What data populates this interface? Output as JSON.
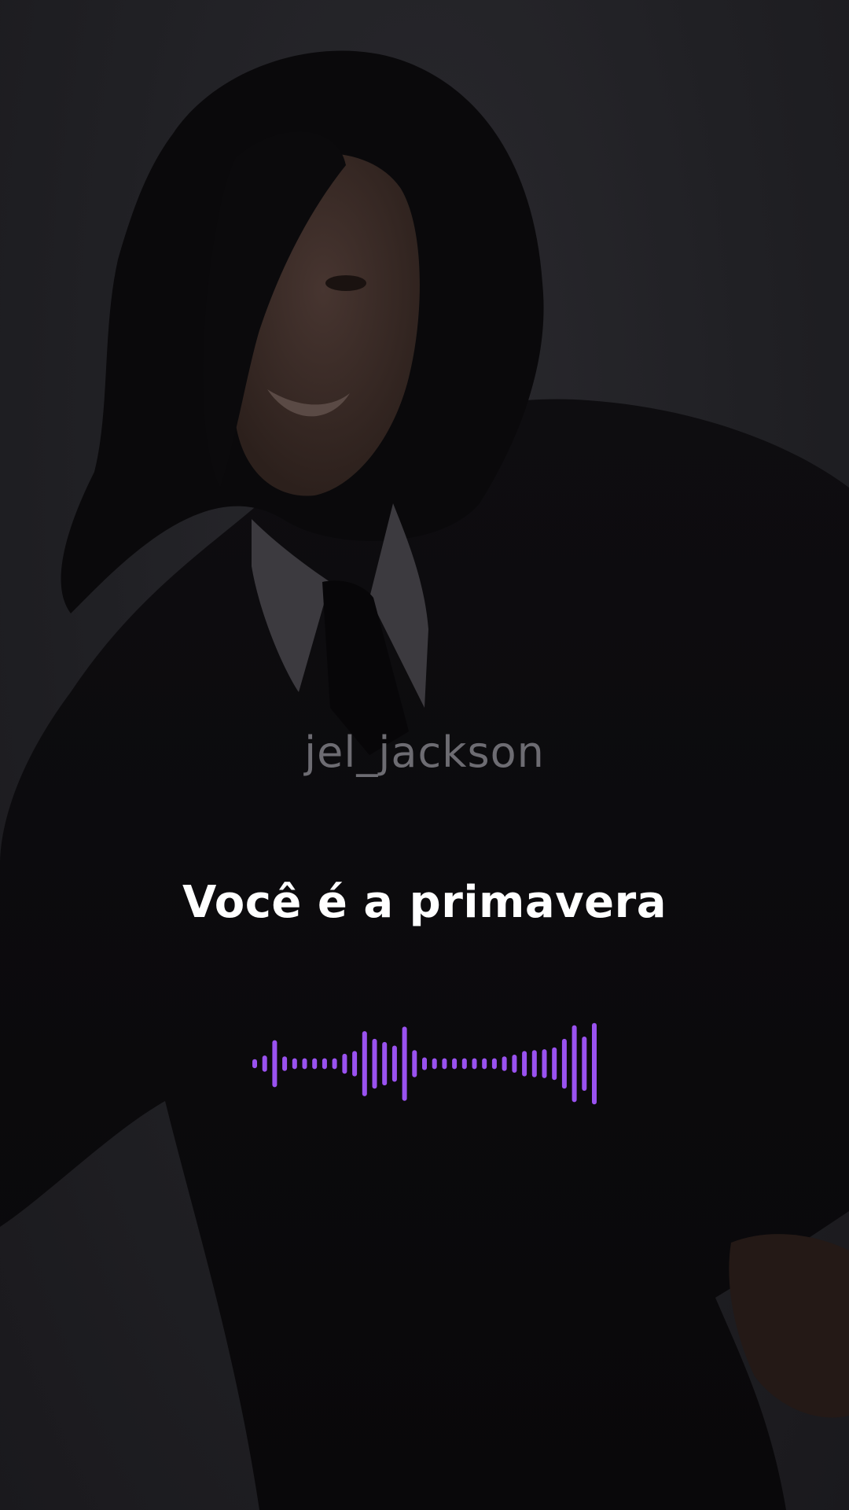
{
  "overlay": {
    "watermark": "jel_jackson",
    "lyric": "Você é a primavera"
  },
  "visualizer": {
    "color": "#9a52f0",
    "levels": [
      0.1,
      0.18,
      0.52,
      0.16,
      0.12,
      0.12,
      0.12,
      0.12,
      0.12,
      0.22,
      0.28,
      0.72,
      0.55,
      0.48,
      0.4,
      0.82,
      0.3,
      0.14,
      0.12,
      0.12,
      0.12,
      0.12,
      0.12,
      0.12,
      0.12,
      0.16,
      0.2,
      0.28,
      0.3,
      0.32,
      0.36,
      0.55,
      0.85,
      0.6,
      0.9
    ]
  },
  "colors": {
    "background": "#1d1c20",
    "shirt": "#0c0b0e",
    "hair": "#0b0a0c",
    "skin": "#3a2b26",
    "collar": "#3c3a3f",
    "text": "#ffffff",
    "watermark": "#6d6c72"
  }
}
